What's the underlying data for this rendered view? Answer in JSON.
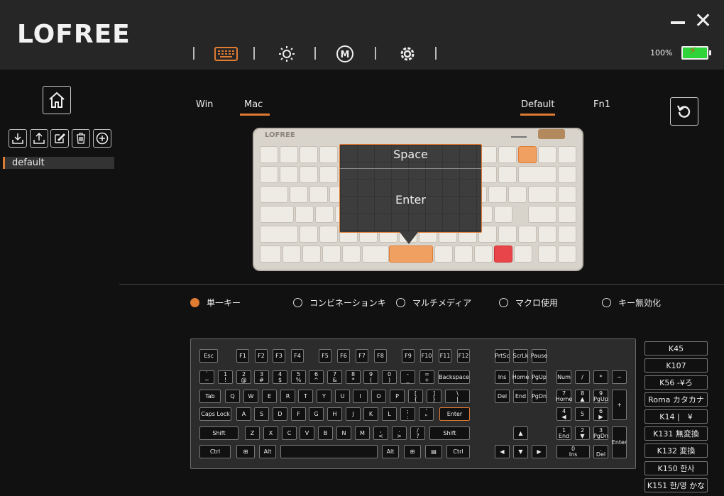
{
  "app": {
    "logo": "LOFREE"
  },
  "nav": {
    "icons": [
      "keyboard-icon",
      "brightness-icon",
      "macro-icon",
      "settings-icon"
    ],
    "active": "keyboard",
    "accent": "#e07b32"
  },
  "window": {
    "minimize": "—",
    "close": "✕"
  },
  "battery": {
    "percent": "100%",
    "color": "#2fd33a"
  },
  "sidebar": {
    "toolbar": [
      "import-icon",
      "export-icon",
      "edit-icon",
      "delete-icon",
      "add-icon"
    ],
    "profiles": [
      "default"
    ]
  },
  "os_tabs": [
    "Win",
    "Mac"
  ],
  "os_active": "Mac",
  "layer_tabs": [
    "Default",
    "Fn1"
  ],
  "layer_active": "Default",
  "keyboard_preview": {
    "brand": "LOFREE"
  },
  "popup": {
    "top": "Space",
    "bottom": "Enter"
  },
  "modes": [
    {
      "label": "単一キー",
      "selected": true
    },
    {
      "label": "コンビネーションキ",
      "selected": false
    },
    {
      "label": "マルチメディア",
      "selected": false
    },
    {
      "label": "マクロ使用",
      "selected": false
    },
    {
      "label": "キー無効化",
      "selected": false
    }
  ],
  "keys": {
    "esc": "Esc",
    "f1": "F1",
    "f2": "F2",
    "f3": "F3",
    "f4": "F4",
    "f5": "F5",
    "f6": "F6",
    "f7": "F7",
    "f8": "F8",
    "f9": "F9",
    "f10": "F10",
    "f11": "F11",
    "f12": "F12",
    "prtsc": "PrtSc",
    "scrlk": "ScrLk",
    "pause": "Pause",
    "grave": "`\n~",
    "n1": "1\n!",
    "n2": "2\n@",
    "n3": "3\n#",
    "n4": "4\n$",
    "n5": "5\n%",
    "n6": "6\n^",
    "n7": "7\n&",
    "n8": "8\n*",
    "n9": "9\n(",
    "n0": "0\n)",
    "minus": "-\n_",
    "equal": "=\n+",
    "backspace": "Backspace",
    "ins": "Ins",
    "home": "Home",
    "pgup": "PgUp",
    "numlk": "Num",
    "kpdiv": "/",
    "kpmul": "*",
    "kpsub": "−",
    "tab": "Tab",
    "q": "Q",
    "w": "W",
    "e": "E",
    "r": "R",
    "t": "T",
    "y": "Y",
    "u": "U",
    "i": "I",
    "o": "O",
    "p": "P",
    "lbr": "[\n{",
    "rbr": "]\n}",
    "bslash": "\\\n|",
    "del": "Del",
    "end": "End",
    "pgdn": "PgDn",
    "kp7": "7\nHome",
    "kp8": "8\n▲",
    "kp9": "9\nPgUp",
    "kpadd": "+",
    "caps": "Caps Lock",
    "a": "A",
    "s": "S",
    "d": "D",
    "f": "F",
    "g": "G",
    "h": "H",
    "j": "J",
    "k": "K",
    "l": "L",
    "semi": ";\n:",
    "quote": "'\n\"",
    "enter": "Enter",
    "kp4": "4\n◀",
    "kp5": "5",
    "kp6": "6\n▶",
    "lshift": "Shift",
    "z": "Z",
    "x": "X",
    "c": "C",
    "v": "V",
    "b": "B",
    "n": "N",
    "m": "M",
    "comma": ",\n<",
    "period": ".\n>",
    "slash": "/\n?",
    "rshift": "Shift",
    "up": "▲",
    "kp1": "1\nEnd",
    "kp2": "2\n▼",
    "kp3": "3\nPgDn",
    "kpenter": "Enter",
    "lctrl": "Ctrl",
    "lwin": "⊞",
    "lalt": "Alt",
    "space": "",
    "ralt": "Alt",
    "rwin": "⊞",
    "menu": "▤",
    "rctrl": "Ctrl",
    "left": "◀",
    "down": "▼",
    "right": "▶",
    "kp0": "0\nIns",
    "kpdot": ".\nDel"
  },
  "extra_keys": [
    "K45",
    "K107",
    "K56 -¥ろ",
    "Roma カタカナ",
    "K14 |　¥",
    "K131 無変換",
    "K132 変換",
    "K150 한사",
    "K151 한/영 かな"
  ]
}
